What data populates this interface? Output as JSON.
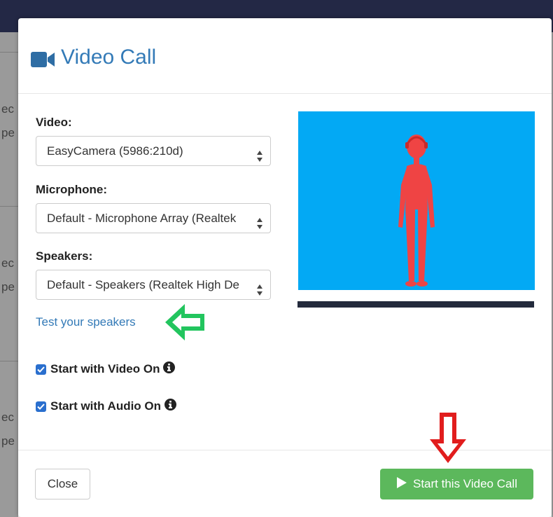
{
  "background": {
    "fragments": [
      "ec",
      "pe",
      "ec",
      "pe",
      "ec",
      "pe"
    ]
  },
  "dialog": {
    "title": "Video Call",
    "title_icon": "video-camera-icon",
    "video": {
      "label": "Video:",
      "selected": "EasyCamera (5986:210d)"
    },
    "microphone": {
      "label": "Microphone:",
      "selected": "Default - Microphone Array (Realtek"
    },
    "speakers": {
      "label": "Speakers:",
      "selected": "Default - Speakers (Realtek High De"
    },
    "test_speakers_link": "Test your speakers",
    "options": {
      "video_on": {
        "label": "Start with Video On",
        "checked": true
      },
      "audio_on": {
        "label": "Start with Audio On",
        "checked": true
      }
    },
    "footer": {
      "close_label": "Close",
      "start_label": "Start this Video Call"
    }
  },
  "colors": {
    "title": "#337ab7",
    "link": "#337ab7",
    "primary_green": "#5cb85c",
    "preview_background": "#03a9f4",
    "avatar": "#ef4444",
    "annotation_green_arrow": "#22c55e",
    "annotation_red_arrow": "#e11d1d",
    "checkbox": "#2a6fce"
  },
  "icons": [
    "video-camera-icon",
    "select-arrows-icon",
    "info-icon",
    "play-icon",
    "checkbox-checked-icon"
  ]
}
